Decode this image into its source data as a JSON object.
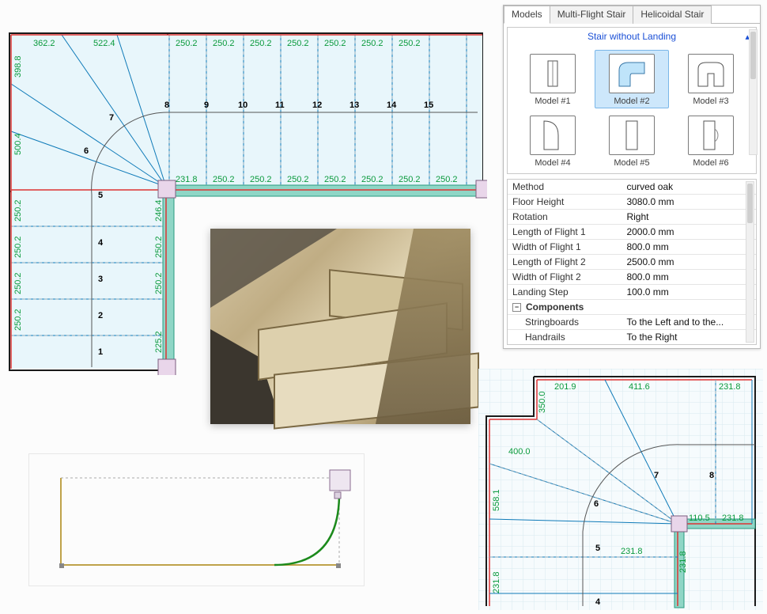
{
  "tabs": {
    "models": "Models",
    "multi": "Multi-Flight Stair",
    "heli": "Helicoidal Stair"
  },
  "accordion_title": "Stair without Landing",
  "models": {
    "m1": "Model #1",
    "m2": "Model #2",
    "m3": "Model #3",
    "m4": "Model #4",
    "m5": "Model #5",
    "m6": "Model #6"
  },
  "props": {
    "method_k": "Method",
    "method_v": "curved oak",
    "fh_k": "Floor Height",
    "fh_v": "3080.0 mm",
    "rot_k": "Rotation",
    "rot_v": "Right",
    "lf1_k": "Length of Flight 1",
    "lf1_v": "2000.0 mm",
    "wf1_k": "Width of Flight 1",
    "wf1_v": "800.0 mm",
    "lf2_k": "Length of Flight 2",
    "lf2_v": "2500.0 mm",
    "wf2_k": "Width of Flight 2",
    "wf2_v": "800.0 mm",
    "land_k": "Landing Step",
    "land_v": "100.0 mm",
    "comp_k": "Components",
    "sb_k": "Stringboards",
    "sb_v": "To the Left and to the...",
    "hr_k": "Handrails",
    "hr_v": "To the Right"
  },
  "plan_tl": {
    "top_dims": {
      "d1": "362.2",
      "d2": "522.4",
      "d3": "250.2",
      "d4": "250.2",
      "d5": "250.2",
      "d6": "250.2",
      "d7": "250.2",
      "d8": "250.2",
      "d9": "250.2"
    },
    "mid_dims": {
      "m0": "231.8",
      "m1": "250.2",
      "m2": "250.2",
      "m3": "250.2",
      "m4": "250.2",
      "m5": "250.2",
      "m6": "250.2",
      "m7": "250.2"
    },
    "left_dims": {
      "l1": "398.8",
      "l2": "500.4",
      "l3": "250.2",
      "l4": "250.2",
      "l5": "250.2",
      "l6": "250.2"
    },
    "inner_vdims": {
      "iv1": "246.4",
      "iv2": "250.2",
      "iv3": "250.2",
      "iv4": "225.2"
    },
    "steps": {
      "s1": "1",
      "s2": "2",
      "s3": "3",
      "s4": "4",
      "s5": "5",
      "s6": "6",
      "s7": "7",
      "s8": "8",
      "s9": "9",
      "s10": "10",
      "s11": "11",
      "s12": "12",
      "s13": "13",
      "s14": "14",
      "s15": "15"
    }
  },
  "plan_br": {
    "top": {
      "t1": "201.9",
      "t2": "411.6",
      "t3": "231.8"
    },
    "left": {
      "l1": "350.0",
      "l2": "400.0",
      "l3": "558.1",
      "l4": "231.8"
    },
    "right": {
      "r1": "110.5",
      "r2": "231.8",
      "r3": "231.8",
      "r4": "231.8"
    },
    "steps": {
      "s4": "4",
      "s5": "5",
      "s6": "6",
      "s7": "7",
      "s8": "8"
    }
  }
}
